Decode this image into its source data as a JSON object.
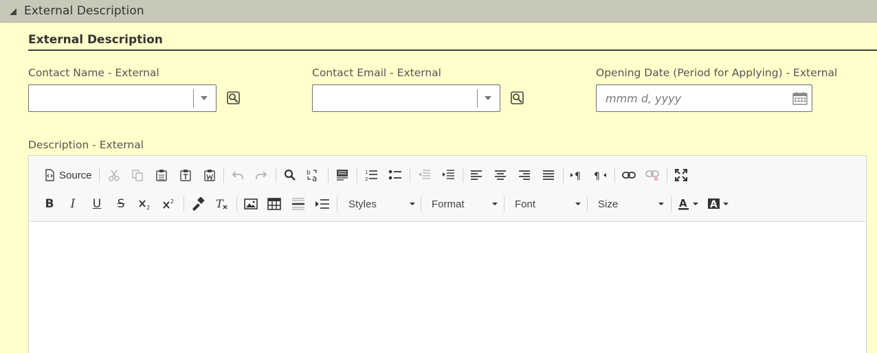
{
  "section": {
    "title": "External Description"
  },
  "subsection": {
    "title": "External Description"
  },
  "fields": {
    "contact_name": {
      "label": "Contact Name - External",
      "value": ""
    },
    "contact_email": {
      "label": "Contact Email - External",
      "value": ""
    },
    "opening_date": {
      "label": "Opening Date (Period for Applying) - External",
      "placeholder": "mmm d, yyyy"
    },
    "description": {
      "label": "Description - External"
    }
  },
  "toolbar": {
    "source_label": "Source",
    "styles_label": "Styles",
    "format_label": "Format",
    "font_label": "Font",
    "size_label": "Size"
  },
  "colors": {
    "page_bg": "#ffffcc",
    "header_bg": "#c8c8b8",
    "text": "#333333"
  }
}
